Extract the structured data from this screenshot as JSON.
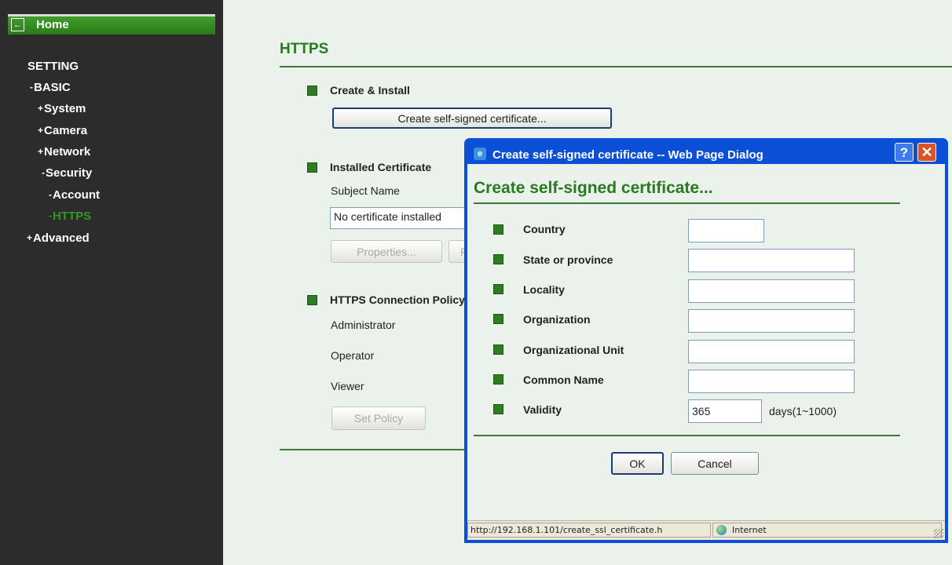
{
  "sidebar": {
    "home_label": "Home",
    "setting": "SETTING",
    "items": [
      {
        "symbol": "-",
        "label": "BASIC"
      },
      {
        "symbol": "+",
        "label": "System"
      },
      {
        "symbol": "+",
        "label": "Camera"
      },
      {
        "symbol": "+",
        "label": "Network"
      },
      {
        "symbol": "-",
        "label": "Security"
      },
      {
        "symbol": "-",
        "label": "Account"
      },
      {
        "symbol": "-",
        "label": "HTTPS"
      },
      {
        "symbol": "+",
        "label": "Advanced"
      }
    ],
    "active_item": "HTTPS"
  },
  "main": {
    "title": "HTTPS",
    "create_install": {
      "heading": "Create & Install",
      "button": "Create self-signed certificate..."
    },
    "installed": {
      "heading": "Installed Certificate",
      "subject_label": "Subject Name",
      "subject_value": "No certificate installed",
      "properties_button": "Properties...",
      "remove_button_partial": "R"
    },
    "policy": {
      "heading": "HTTPS Connection Policy",
      "administrator": "Administrator",
      "operator": "Operator",
      "viewer": "Viewer",
      "set_policy_button": "Set Policy"
    }
  },
  "dialog": {
    "title": "Create self-signed certificate -- Web Page Dialog",
    "help_glyph": "?",
    "close_glyph": "✕",
    "heading": "Create self-signed certificate...",
    "fields": {
      "country": "Country",
      "state": "State or province",
      "locality": "Locality",
      "organization": "Organization",
      "org_unit": "Organizational Unit",
      "common_name": "Common Name",
      "validity": "Validity"
    },
    "validity_value": "365",
    "validity_unit": "days(1~1000)",
    "ok_button": "OK",
    "cancel_button": "Cancel",
    "status_url": "http://192.168.1.101/create_ssl_certificate.h",
    "status_zone": "Internet"
  },
  "colors": {
    "accent_green": "#2a7a1f",
    "sidebar_bg": "#2c2c2c",
    "dialog_frame": "#0b4fd6",
    "content_bg": "#ebf1eb"
  }
}
